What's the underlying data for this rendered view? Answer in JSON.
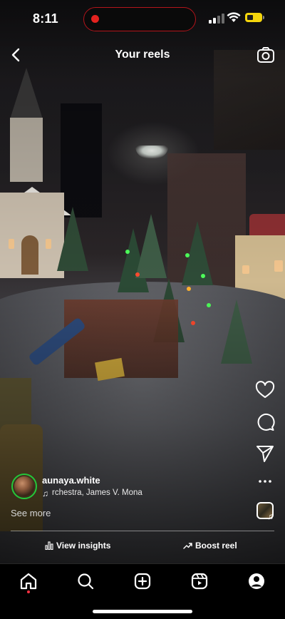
{
  "status_bar": {
    "time": "8:11",
    "recording": true,
    "signal_bars": 2,
    "battery_color": "#f5d60c"
  },
  "header": {
    "title": "Your reels",
    "back_icon": "chevron-left-icon",
    "camera_icon": "camera-icon"
  },
  "actions": {
    "like_icon": "heart-icon",
    "comment_icon": "comment-icon",
    "share_icon": "send-icon",
    "more_icon": "more-horizontal-icon",
    "audio_icon": "audio-thumbnail-icon"
  },
  "author": {
    "username": "aunaya.white",
    "avatar_ring_color": "#24c73a"
  },
  "music": {
    "text": "rchestra,  James V. Mona"
  },
  "caption": {
    "see_more": "See more"
  },
  "footer": {
    "view_insights": "View insights",
    "boost_reel": "Boost reel"
  },
  "tab_bar": {
    "tabs": [
      "home-icon",
      "search-icon",
      "create-icon",
      "reels-icon",
      "profile-icon"
    ],
    "active_tab": "home-icon",
    "notification_dot_color": "#ff3040"
  }
}
